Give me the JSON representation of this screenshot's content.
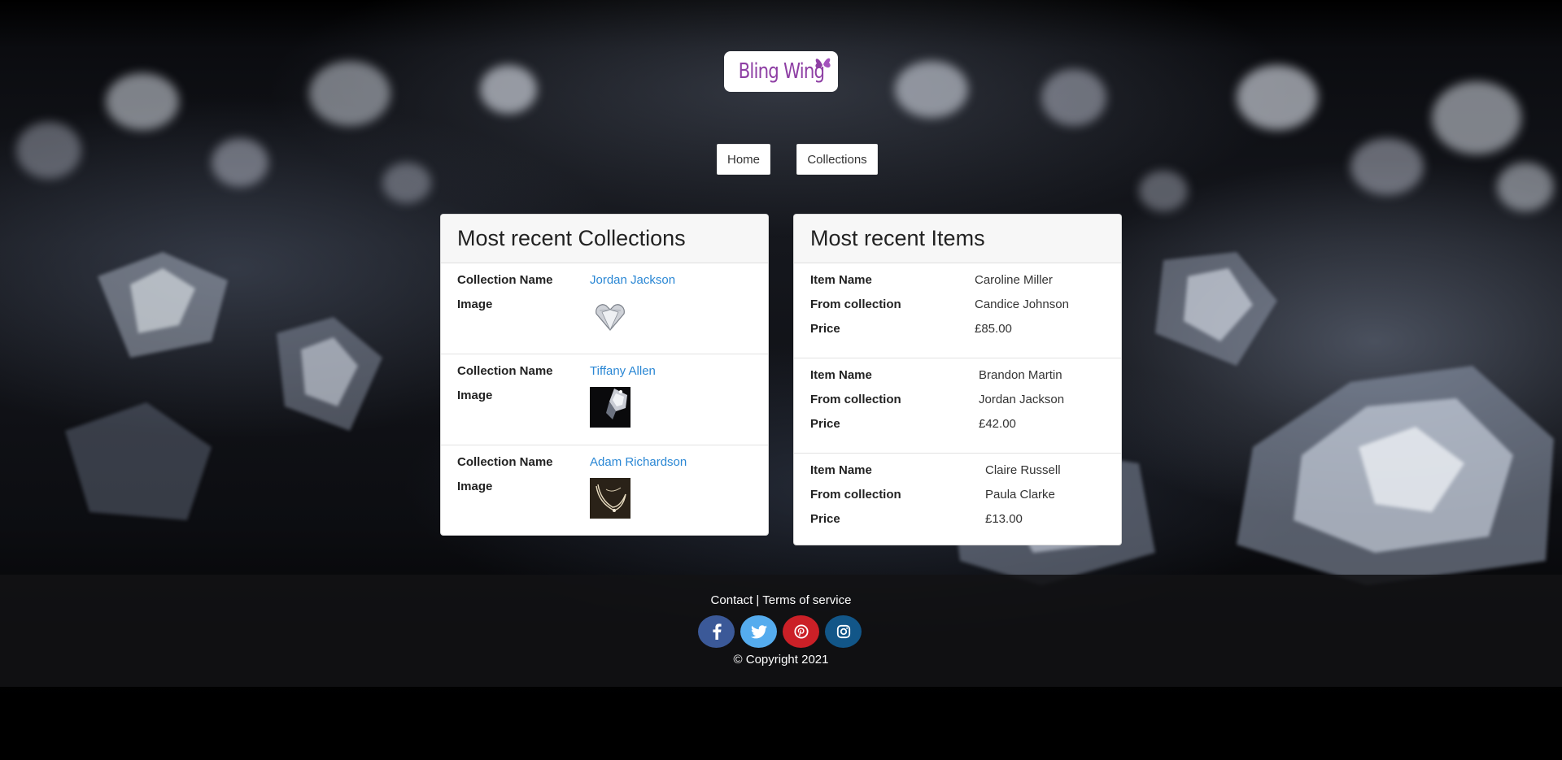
{
  "brand": {
    "logo_text": "Bling Wing",
    "logo_color": "#8e3fa4"
  },
  "nav": {
    "items": [
      {
        "label": "Home"
      },
      {
        "label": "Collections"
      }
    ]
  },
  "collections_card": {
    "title": "Most recent Collections",
    "name_label": "Collection Name",
    "image_label": "Image",
    "entries": [
      {
        "name": "Jordan Jackson",
        "image_icon": "heart-diamond-image"
      },
      {
        "name": "Tiffany Allen",
        "image_icon": "diamond-dark-image"
      },
      {
        "name": "Adam Richardson",
        "image_icon": "necklace-image"
      }
    ]
  },
  "items_card": {
    "title": "Most recent Items",
    "item_label": "Item Name",
    "collection_label": "From collection",
    "price_label": "Price",
    "entries": [
      {
        "name": "Caroline Miller",
        "collection": "Candice Johnson",
        "price": "£85.00"
      },
      {
        "name": "Brandon Martin",
        "collection": "Jordan Jackson",
        "price": "£42.00"
      },
      {
        "name": "Claire Russell",
        "collection": "Paula Clarke",
        "price": "£13.00"
      }
    ]
  },
  "footer": {
    "contact": "Contact",
    "separator": "|",
    "terms": "Terms of service",
    "copyright": "© Copyright 2021",
    "socials": [
      {
        "icon": "facebook-icon",
        "color": "#3b5998"
      },
      {
        "icon": "twitter-icon",
        "color": "#55acee"
      },
      {
        "icon": "pinterest-icon",
        "color": "#cb2027"
      },
      {
        "icon": "instagram-icon",
        "color": "#125688"
      }
    ]
  },
  "colors": {
    "link": "#2a87d4",
    "card_header_bg": "#f7f7f7"
  }
}
